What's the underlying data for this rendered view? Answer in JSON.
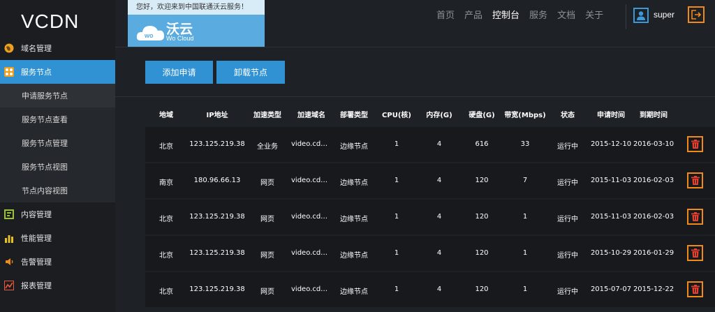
{
  "sidebar": {
    "logo": "VCDN",
    "items": [
      {
        "label": "域名管理",
        "icon": "globe-icon",
        "color": "#f0a020"
      },
      {
        "label": "服务节点",
        "icon": "nodes-icon",
        "color": "#f0a020",
        "active": true
      },
      {
        "label": "内容管理",
        "icon": "content-icon",
        "color": "#9bc33a"
      },
      {
        "label": "性能管理",
        "icon": "bar-chart-icon",
        "color": "#e8c020"
      },
      {
        "label": "告警管理",
        "icon": "speaker-icon",
        "color": "#f08a18"
      },
      {
        "label": "报表管理",
        "icon": "report-icon",
        "color": "#e85a3a"
      }
    ],
    "subitems": [
      "申请服务节点",
      "服务节点查看",
      "服务节点管理",
      "服务节点视图",
      "节点内容视图"
    ]
  },
  "header": {
    "welcome": "您好，欢迎来到中国联通沃云服务！",
    "brand_cn": "沃云",
    "brand_en": "Wo Cloud",
    "nav": [
      "首页",
      "产品",
      "控制台",
      "服务",
      "文档",
      "关于"
    ],
    "active_nav": "控制台",
    "username": "super"
  },
  "toolbar": {
    "add_label": "添加申请",
    "unload_label": "卸载节点"
  },
  "table": {
    "headers": [
      "地域",
      "IP地址",
      "加速类型",
      "加速域名",
      "部署类型",
      "CPU(核)",
      "内存(G)",
      "硬盘(G)",
      "带宽(Mbps)",
      "状态",
      "申请时间",
      "到期时间"
    ],
    "rows": [
      [
        "北京",
        "123.125.219.38",
        "全业务",
        "video.cdn...",
        "边缘节点",
        "1",
        "4",
        "616",
        "33",
        "运行中",
        "2015-12-10",
        "2016-03-10"
      ],
      [
        "南京",
        "180.96.66.13",
        "网页",
        "video.cdn...",
        "边缘节点",
        "1",
        "4",
        "120",
        "7",
        "运行中",
        "2015-11-03",
        "2016-02-03"
      ],
      [
        "北京",
        "123.125.219.38",
        "网页",
        "video.cdn...",
        "边缘节点",
        "1",
        "4",
        "120",
        "1",
        "运行中",
        "2015-11-03",
        "2016-02-03"
      ],
      [
        "北京",
        "123.125.219.38",
        "网页",
        "video.cdn...",
        "边缘节点",
        "1",
        "4",
        "120",
        "1",
        "运行中",
        "2015-10-29",
        "2016-01-29"
      ],
      [
        "北京",
        "123.125.219.38",
        "网页",
        "video.cdn...",
        "边缘节点",
        "1",
        "4",
        "120",
        "1",
        "运行中",
        "2015-07-07",
        "2015-12-22"
      ]
    ]
  },
  "colors": {
    "accent": "#3092d2",
    "delete_border": "#f08a18",
    "delete_icon": "#e8402a"
  }
}
